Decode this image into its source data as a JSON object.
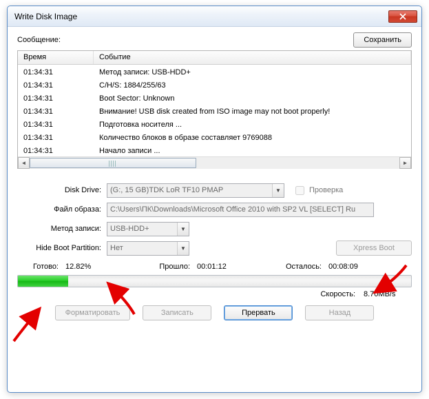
{
  "window": {
    "title": "Write Disk Image"
  },
  "message_label": "Сообщение:",
  "save_btn": "Сохранить",
  "log": {
    "head_time": "Время",
    "head_event": "Событие",
    "rows": [
      {
        "time": "01:34:31",
        "event": "Метод записи: USB-HDD+"
      },
      {
        "time": "01:34:31",
        "event": "C/H/S: 1884/255/63"
      },
      {
        "time": "01:34:31",
        "event": "Boot Sector: Unknown"
      },
      {
        "time": "01:34:31",
        "event": "Внимание! USB disk created from ISO image may not boot properly!"
      },
      {
        "time": "01:34:31",
        "event": "Подготовка носителя ..."
      },
      {
        "time": "01:34:31",
        "event": "Количество блоков в образе составляет 9769088"
      },
      {
        "time": "01:34:31",
        "event": "Начало записи ..."
      }
    ]
  },
  "fields": {
    "disk_drive_label": "Disk Drive:",
    "disk_drive_value": "(G:, 15 GB)TDK LoR TF10           PMAP",
    "check_label": "Проверка",
    "image_label": "Файл образа:",
    "image_value": "C:\\Users\\ПК\\Downloads\\Microsoft Office 2010 with SP2 VL [SELECT] Ru",
    "method_label": "Метод записи:",
    "method_value": "USB-HDD+",
    "hide_label": "Hide Boot Partition:",
    "hide_value": "Нет",
    "xpress_btn": "Xpress Boot"
  },
  "status": {
    "done_label": "Готово:",
    "done_value": "12.82%",
    "elapsed_label": "Прошло:",
    "elapsed_value": "00:01:12",
    "remain_label": "Осталось:",
    "remain_value": "00:08:09",
    "speed_label": "Скорость:",
    "speed_value": "8.70MB/s",
    "progress_pct": 12.82
  },
  "buttons": {
    "format": "Форматировать",
    "write": "Записать",
    "abort": "Прервать",
    "back": "Назад"
  }
}
